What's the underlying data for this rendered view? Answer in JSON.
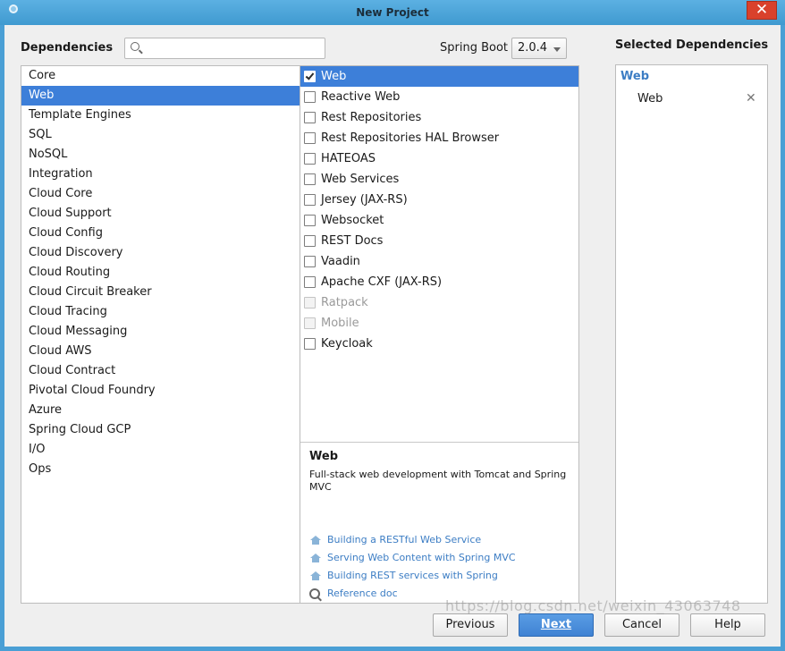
{
  "window": {
    "title": "New Project",
    "close_glyph": "✕"
  },
  "header": {
    "dependencies_label": "Dependencies",
    "search": {
      "value": "",
      "placeholder": ""
    },
    "spring_boot_label": "Spring Boot",
    "spring_boot_version": "2.0.4",
    "selected_label": "Selected Dependencies"
  },
  "categories": [
    "Core",
    "Web",
    "Template Engines",
    "SQL",
    "NoSQL",
    "Integration",
    "Cloud Core",
    "Cloud Support",
    "Cloud Config",
    "Cloud Discovery",
    "Cloud Routing",
    "Cloud Circuit Breaker",
    "Cloud Tracing",
    "Cloud Messaging",
    "Cloud AWS",
    "Cloud Contract",
    "Pivotal Cloud Foundry",
    "Azure",
    "Spring Cloud GCP",
    "I/O",
    "Ops"
  ],
  "selected_category": "Web",
  "dependencies": [
    {
      "label": "Web",
      "checked": true,
      "enabled": true
    },
    {
      "label": "Reactive Web",
      "checked": false,
      "enabled": true
    },
    {
      "label": "Rest Repositories",
      "checked": false,
      "enabled": true
    },
    {
      "label": "Rest Repositories HAL Browser",
      "checked": false,
      "enabled": true
    },
    {
      "label": "HATEOAS",
      "checked": false,
      "enabled": true
    },
    {
      "label": "Web Services",
      "checked": false,
      "enabled": true
    },
    {
      "label": "Jersey (JAX-RS)",
      "checked": false,
      "enabled": true
    },
    {
      "label": "Websocket",
      "checked": false,
      "enabled": true
    },
    {
      "label": "REST Docs",
      "checked": false,
      "enabled": true
    },
    {
      "label": "Vaadin",
      "checked": false,
      "enabled": true
    },
    {
      "label": "Apache CXF (JAX-RS)",
      "checked": false,
      "enabled": true
    },
    {
      "label": "Ratpack",
      "checked": false,
      "enabled": false
    },
    {
      "label": "Mobile",
      "checked": false,
      "enabled": false
    },
    {
      "label": "Keycloak",
      "checked": false,
      "enabled": true
    }
  ],
  "detail": {
    "title": "Web",
    "description": "Full-stack web development with Tomcat and Spring MVC",
    "links": [
      {
        "label": "Building a RESTful Web Service",
        "icon": "guide-icon"
      },
      {
        "label": "Serving Web Content with Spring MVC",
        "icon": "guide-icon"
      },
      {
        "label": "Building REST services with Spring",
        "icon": "guide-icon"
      },
      {
        "label": "Reference doc",
        "icon": "reference-icon"
      }
    ]
  },
  "selected_dependencies": {
    "group": "Web",
    "items": [
      {
        "label": "Web",
        "remove_glyph": "✕"
      }
    ]
  },
  "buttons": {
    "previous": "Previous",
    "next": "Next",
    "cancel": "Cancel",
    "help": "Help"
  },
  "watermark": "https://blog.csdn.net/weixin_43063748",
  "colors": {
    "selection": "#3d7fd9",
    "link": "#3c7dc4",
    "title_bar": "#4a9fd5",
    "close_button": "#d9412c"
  }
}
